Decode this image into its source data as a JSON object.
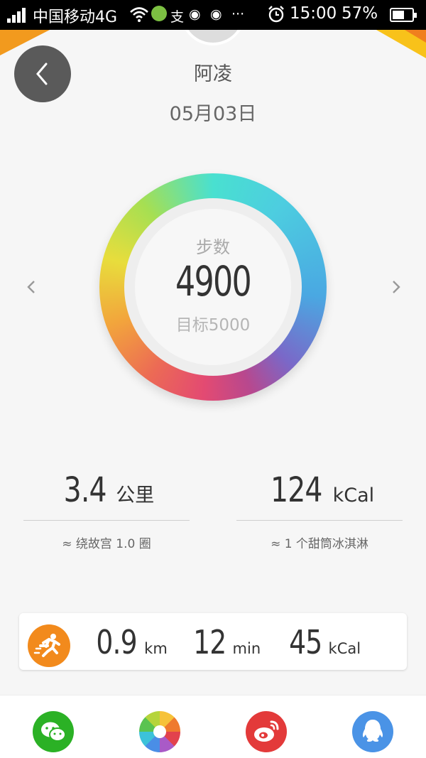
{
  "statusbar": {
    "carrier": "中国移动4G",
    "wechat_notice": "支",
    "time": "15:00",
    "battery": "57%",
    "more": "···"
  },
  "header": {
    "username": "阿凌",
    "date": "05月03日"
  },
  "ring": {
    "label": "步数",
    "steps": "4900",
    "goal": "目标5000",
    "progress": 0.98
  },
  "stats": {
    "distance_value": "3.4",
    "distance_unit": "公里",
    "distance_compare": "≈ 绕故宫 1.0 圈",
    "calories_value": "124",
    "calories_unit": "kCal",
    "calories_compare": "≈ 1 个甜筒冰淇淋"
  },
  "workout": {
    "distance_value": "0.9",
    "distance_unit": "km",
    "duration_value": "12",
    "duration_unit": "min",
    "calories_value": "45",
    "calories_unit": "kCal"
  },
  "share": [
    {
      "name": "wechat-icon",
      "color": "#2bb125"
    },
    {
      "name": "moments-icon",
      "color": "#ffffff"
    },
    {
      "name": "weibo-icon",
      "color": "#e33a3a"
    },
    {
      "name": "qq-icon",
      "color": "#4a93e6"
    }
  ],
  "colors": {
    "accent_orange": "#f28a1c",
    "text_dark": "#333333"
  }
}
